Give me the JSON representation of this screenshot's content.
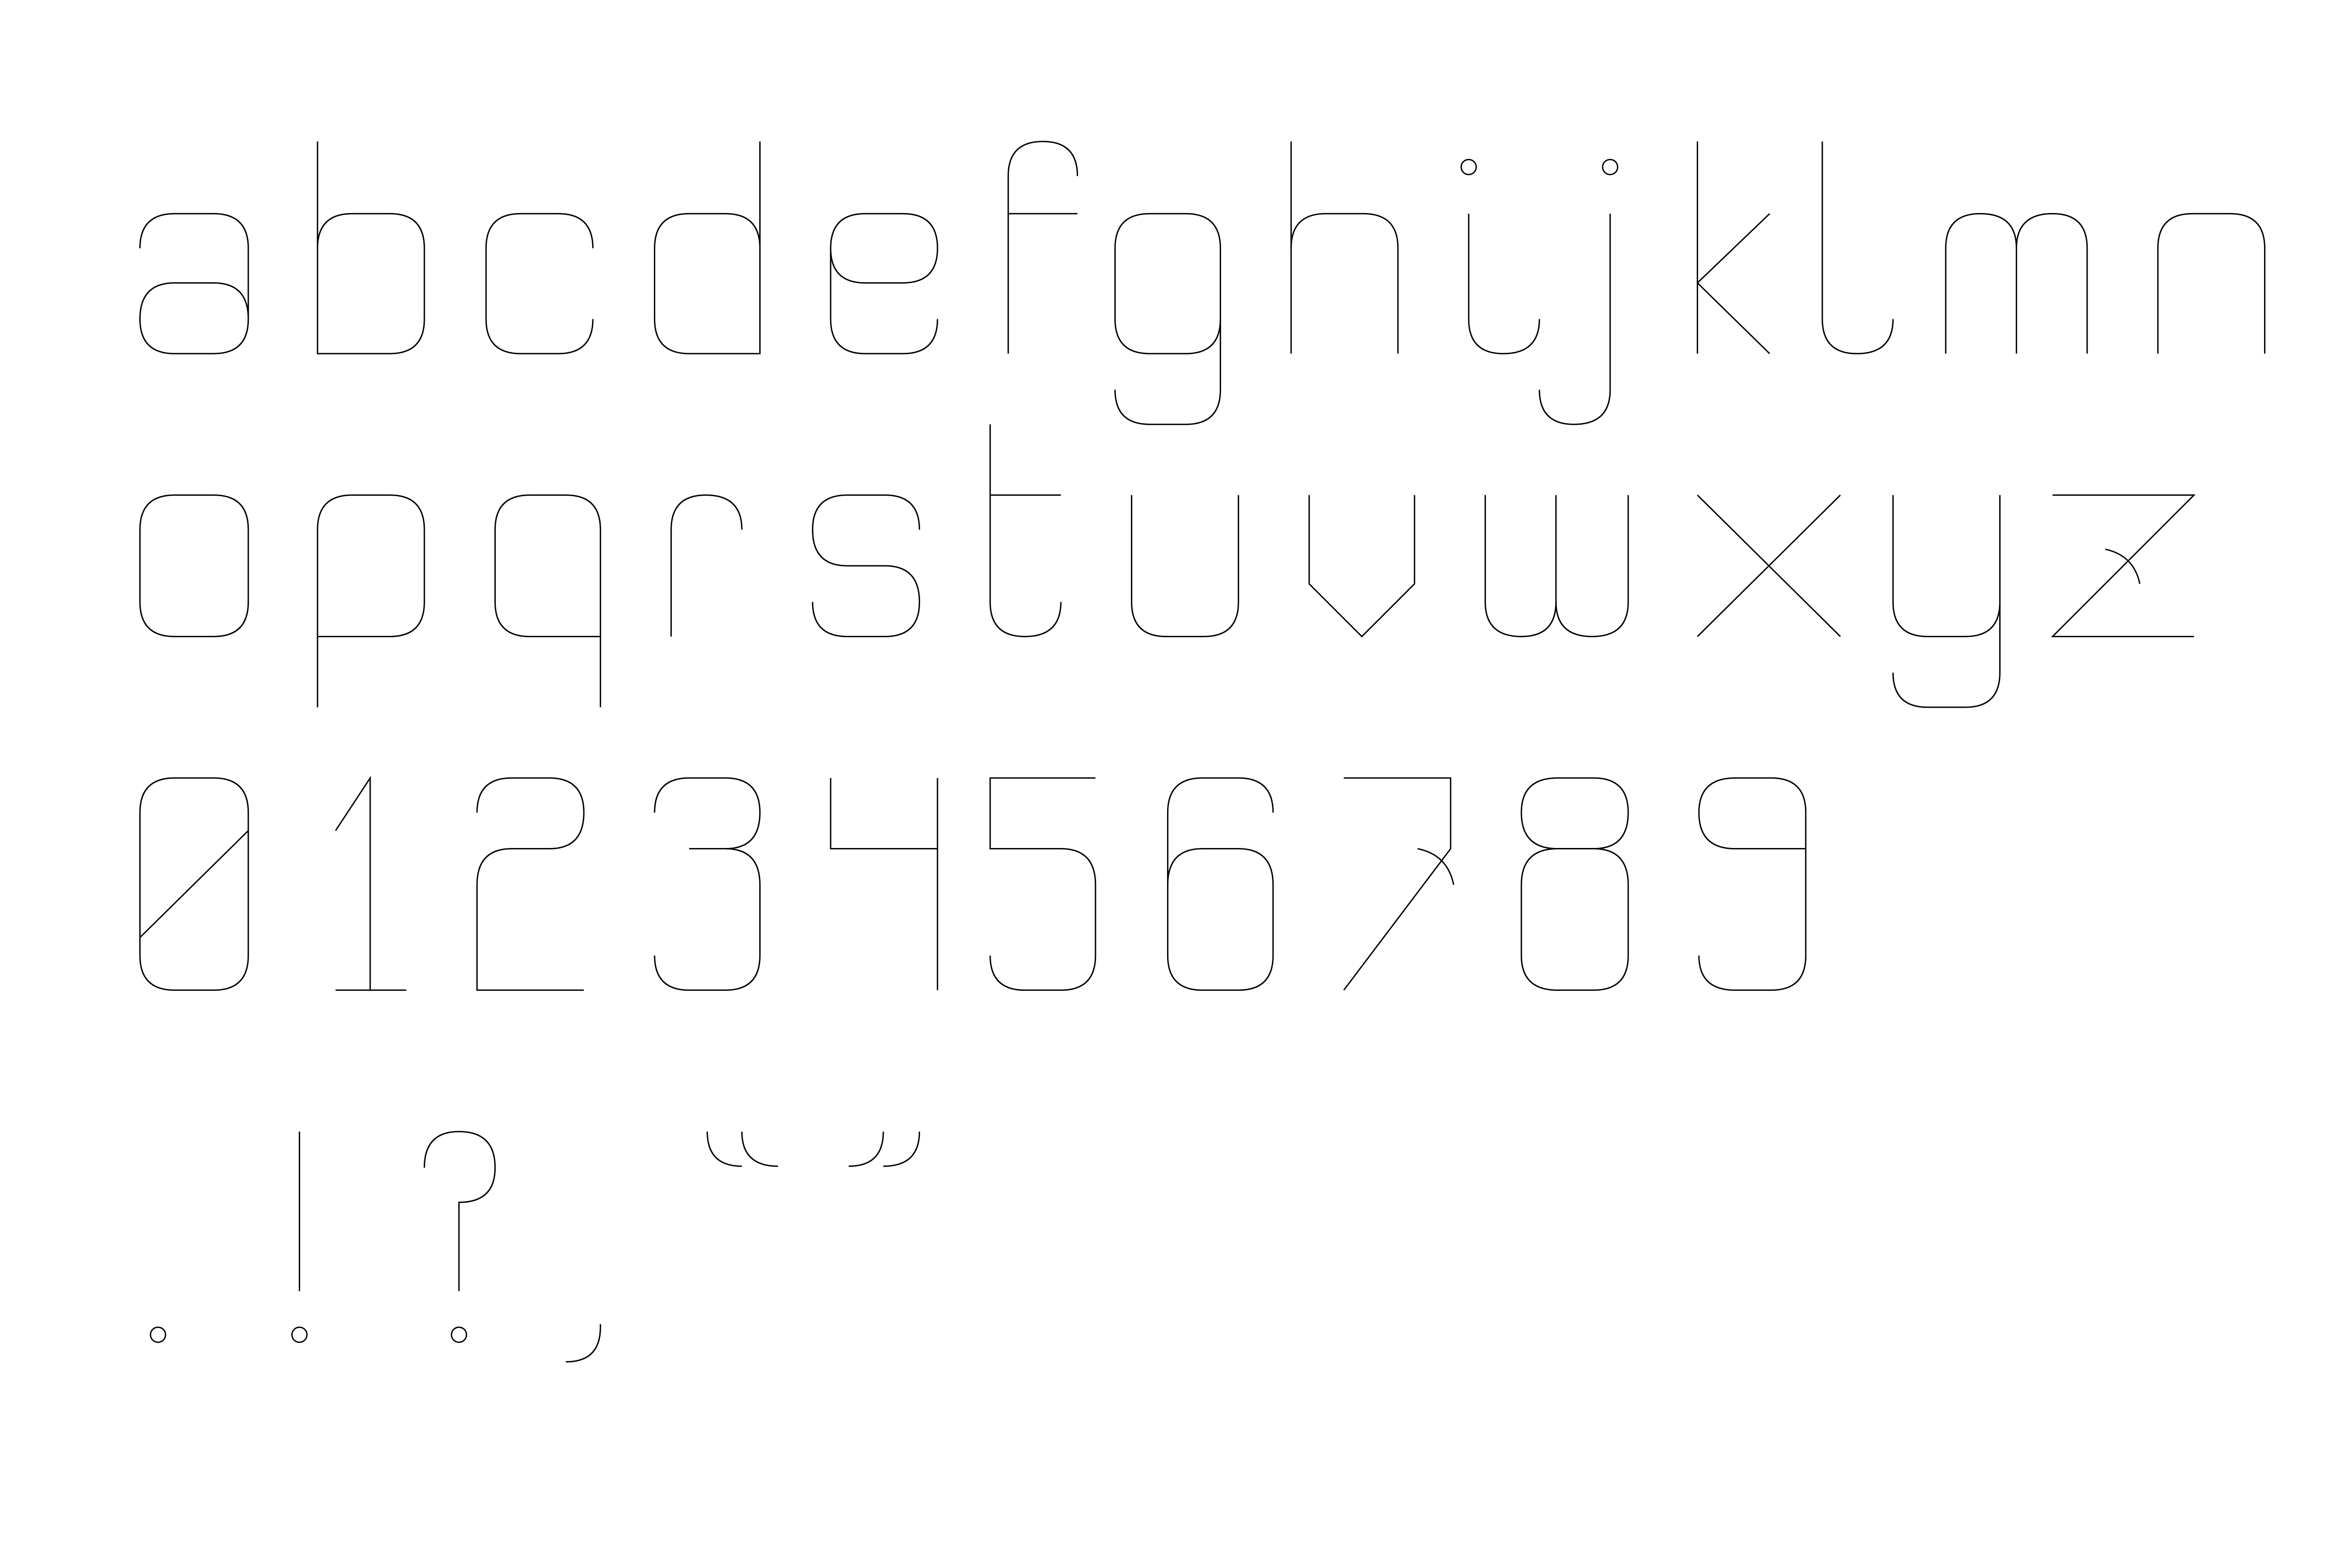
{
  "specimen": {
    "stroke_color": "#000000",
    "background_color": "#ffffff",
    "rows": [
      {
        "name": "lowercase-a-n",
        "glyphs": [
          "a",
          "b",
          "c",
          "d",
          "e",
          "f",
          "g",
          "h",
          "i",
          "j",
          "k",
          "l",
          "m",
          "n"
        ]
      },
      {
        "name": "lowercase-o-z",
        "glyphs": [
          "o",
          "p",
          "q",
          "r",
          "s",
          "t",
          "u",
          "v",
          "w",
          "x",
          "y",
          "z"
        ]
      },
      {
        "name": "digits",
        "glyphs": [
          "0",
          "1",
          "2",
          "3",
          "4",
          "5",
          "6",
          "7",
          "8",
          "9"
        ]
      },
      {
        "name": "punctuation",
        "glyphs": [
          ".",
          "!",
          "?",
          ",",
          "“",
          "”"
        ]
      }
    ]
  }
}
